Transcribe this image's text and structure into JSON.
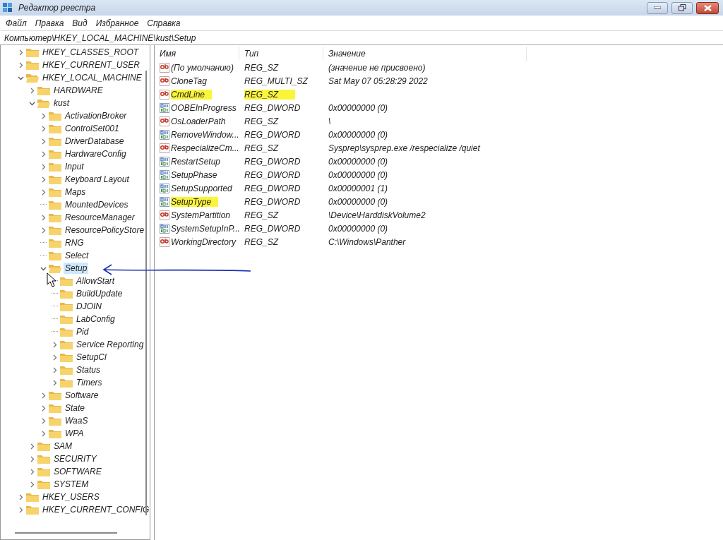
{
  "window": {
    "title": "Редактор реестра"
  },
  "menu": [
    "Файл",
    "Правка",
    "Вид",
    "Избранное",
    "Справка"
  ],
  "address": "Компьютер\\HKEY_LOCAL_MACHINE\\kust\\Setup",
  "tree": [
    {
      "label": "HKEY_CLASSES_ROOT",
      "expanded": false,
      "selected": false
    },
    {
      "label": "HKEY_CURRENT_USER",
      "expanded": false,
      "selected": false
    },
    {
      "label": "HKEY_LOCAL_MACHINE",
      "expanded": true,
      "selected": false,
      "children": [
        {
          "label": "HARDWARE",
          "expanded": false,
          "selected": false
        },
        {
          "label": "kust",
          "expanded": true,
          "selected": false,
          "children": [
            {
              "label": "ActivationBroker",
              "expanded": false,
              "selected": false
            },
            {
              "label": "ControlSet001",
              "expanded": false,
              "selected": false
            },
            {
              "label": "DriverDatabase",
              "expanded": false,
              "selected": false
            },
            {
              "label": "HardwareConfig",
              "expanded": false,
              "selected": false
            },
            {
              "label": "Input",
              "expanded": false,
              "selected": false
            },
            {
              "label": "Keyboard Layout",
              "expanded": false,
              "selected": false
            },
            {
              "label": "Maps",
              "expanded": false,
              "selected": false
            },
            {
              "label": "MountedDevices",
              "selected": false
            },
            {
              "label": "ResourceManager",
              "expanded": false,
              "selected": false
            },
            {
              "label": "ResourcePolicyStore",
              "expanded": false,
              "selected": false
            },
            {
              "label": "RNG",
              "selected": false
            },
            {
              "label": "Select",
              "selected": false
            },
            {
              "label": "Setup",
              "expanded": true,
              "selected": true,
              "children": [
                {
                  "label": "AllowStart",
                  "selected": false
                },
                {
                  "label": "BuildUpdate",
                  "selected": false
                },
                {
                  "label": "DJOIN",
                  "selected": false
                },
                {
                  "label": "LabConfig",
                  "selected": false
                },
                {
                  "label": "Pid",
                  "selected": false
                },
                {
                  "label": "Service Reporting",
                  "expanded": false,
                  "selected": false
                },
                {
                  "label": "SetupCl",
                  "expanded": false,
                  "selected": false
                },
                {
                  "label": "Status",
                  "expanded": false,
                  "selected": false
                },
                {
                  "label": "Timers",
                  "expanded": false,
                  "selected": false
                }
              ]
            },
            {
              "label": "Software",
              "expanded": false,
              "selected": false
            },
            {
              "label": "State",
              "expanded": false,
              "selected": false
            },
            {
              "label": "WaaS",
              "expanded": false,
              "selected": false
            },
            {
              "label": "WPA",
              "expanded": false,
              "selected": false
            }
          ]
        },
        {
          "label": "SAM",
          "expanded": false,
          "selected": false
        },
        {
          "label": "SECURITY",
          "expanded": false,
          "selected": false
        },
        {
          "label": "SOFTWARE",
          "expanded": false,
          "selected": false
        },
        {
          "label": "SYSTEM",
          "expanded": false,
          "selected": false
        }
      ]
    },
    {
      "label": "HKEY_USERS",
      "expanded": false,
      "selected": false
    },
    {
      "label": "HKEY_CURRENT_CONFIG",
      "expanded": false,
      "selected": false
    }
  ],
  "values": {
    "columns": [
      "Имя",
      "Тип",
      "Значение"
    ],
    "rows": [
      {
        "kind": "string",
        "name": "(По умолчанию)",
        "type": "REG_SZ",
        "data": "(значение не присвоено)",
        "name_highlighted": false,
        "type_highlighted": false
      },
      {
        "kind": "string",
        "name": "CloneTag",
        "type": "REG_MULTI_SZ",
        "data": "Sat May 07 05:28:29 2022",
        "name_highlighted": false,
        "type_highlighted": false
      },
      {
        "kind": "string",
        "name": "CmdLine",
        "type": "REG_SZ",
        "name_highlighted": true,
        "type_highlighted": true
      },
      {
        "kind": "binary",
        "name": "OOBEInProgress",
        "type": "REG_DWORD",
        "data": "0x00000000 (0)",
        "name_highlighted": false,
        "type_highlighted": false
      },
      {
        "kind": "string",
        "name": "OsLoaderPath",
        "type": "REG_SZ",
        "data": "\\",
        "name_highlighted": false,
        "type_highlighted": false
      },
      {
        "kind": "binary",
        "name": "RemoveWindow...",
        "type": "REG_DWORD",
        "data": "0x00000000 (0)",
        "name_highlighted": false,
        "type_highlighted": false
      },
      {
        "kind": "string",
        "name": "RespecializeCm...",
        "type": "REG_SZ",
        "data": "Sysprep\\sysprep.exe /respecialize /quiet",
        "name_highlighted": false,
        "type_highlighted": false
      },
      {
        "kind": "binary",
        "name": "RestartSetup",
        "type": "REG_DWORD",
        "data": "0x00000000 (0)",
        "name_highlighted": false,
        "type_highlighted": false
      },
      {
        "kind": "binary",
        "name": "SetupPhase",
        "type": "REG_DWORD",
        "data": "0x00000000 (0)",
        "name_highlighted": false,
        "type_highlighted": false
      },
      {
        "kind": "binary",
        "name": "SetupSupported",
        "type": "REG_DWORD",
        "data": "0x00000001 (1)",
        "name_highlighted": false,
        "type_highlighted": false
      },
      {
        "kind": "binary",
        "name": "SetupType",
        "type": "REG_DWORD",
        "data": "0x00000000 (0)",
        "name_highlighted": true,
        "type_highlighted": false
      },
      {
        "kind": "string",
        "name": "SystemPartition",
        "type": "REG_SZ",
        "data": "\\Device\\HarddiskVolume2",
        "name_highlighted": false,
        "type_highlighted": false
      },
      {
        "kind": "binary",
        "name": "SystemSetupInP...",
        "type": "REG_DWORD",
        "data": "0x00000000 (0)",
        "name_highlighted": false,
        "type_highlighted": false
      },
      {
        "kind": "string",
        "name": "WorkingDirectory",
        "type": "REG_SZ",
        "data": "C:\\Windows\\Panther",
        "name_highlighted": false,
        "type_highlighted": false
      }
    ]
  }
}
